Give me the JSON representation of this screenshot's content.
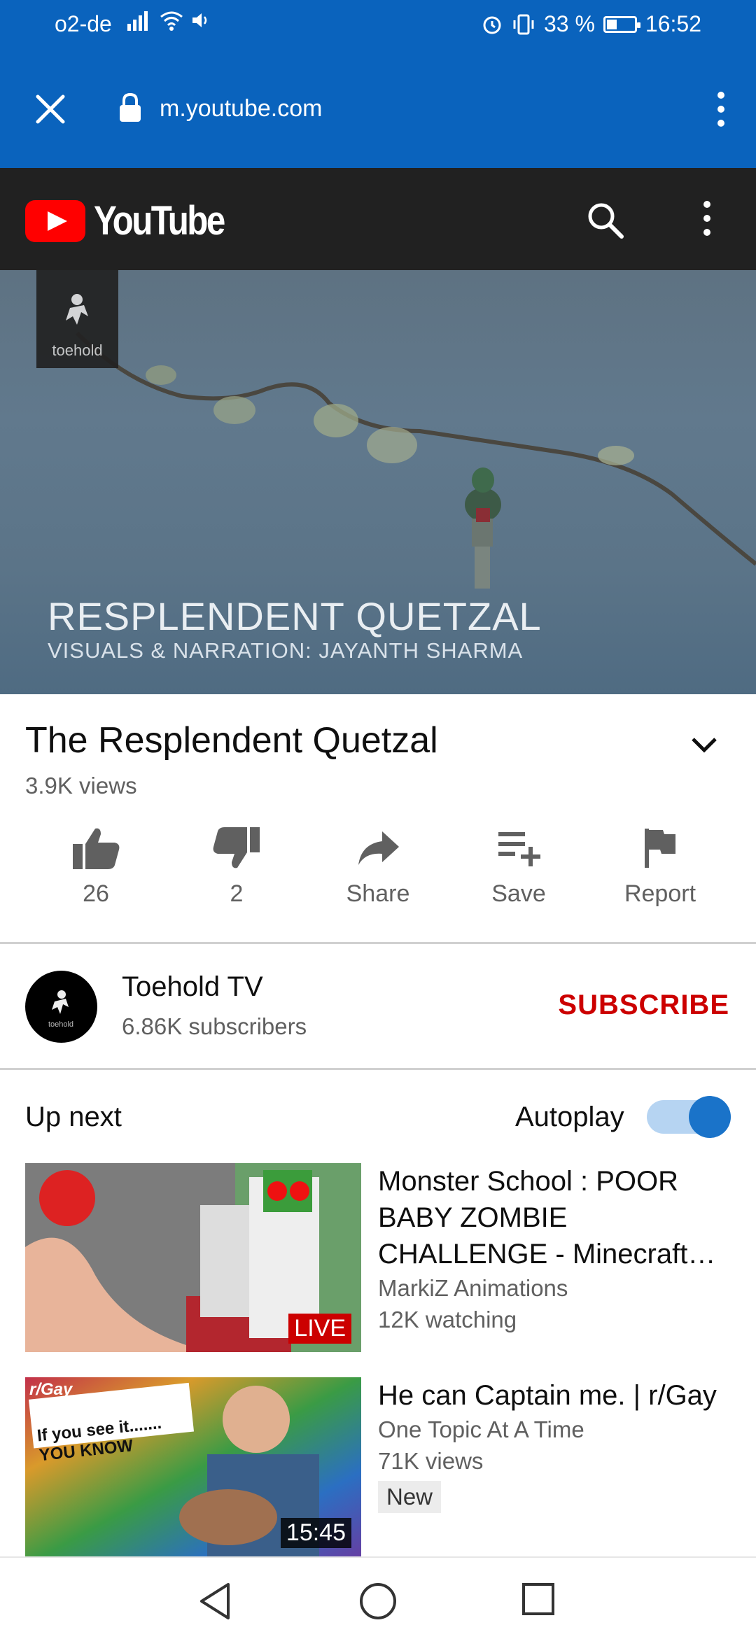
{
  "status": {
    "carrier": "o2-de",
    "battery": "33 %",
    "battery_level": 0.33,
    "time": "16:52"
  },
  "browser": {
    "url": "m.youtube.com"
  },
  "header": {
    "logo_text": "YouTube"
  },
  "video": {
    "overlay_title": "RESPLENDENT QUETZAL",
    "overlay_credit": "VISUALS & NARRATION: JAYANTH SHARMA",
    "watermark": "toehold",
    "title": "The Resplendent Quetzal",
    "views": "3.9K views"
  },
  "actions": {
    "likes": "26",
    "dislikes": "2",
    "share": "Share",
    "save": "Save",
    "report": "Report"
  },
  "channel": {
    "name": "Toehold TV",
    "subscribers": "6.86K subscribers",
    "subscribe_label": "SUBSCRIBE",
    "avatar_text": "toehold"
  },
  "upnext": {
    "label": "Up next",
    "autoplay_label": "Autoplay",
    "autoplay_on": true,
    "items": [
      {
        "title": "Monster School : POOR BABY ZOMBIE CHALLENGE - Minecraft…",
        "channel": "MarkiZ Animations",
        "stat": "12K watching",
        "badge": "LIVE"
      },
      {
        "title": "He can Captain me. | r/Gay",
        "channel": "One Topic At A Time",
        "stat": "71K views",
        "badge": "15:45",
        "tag": "New",
        "thumb_tag": "r/Gay",
        "thumb_caption": "If you see it....... YOU KNOW"
      }
    ]
  }
}
